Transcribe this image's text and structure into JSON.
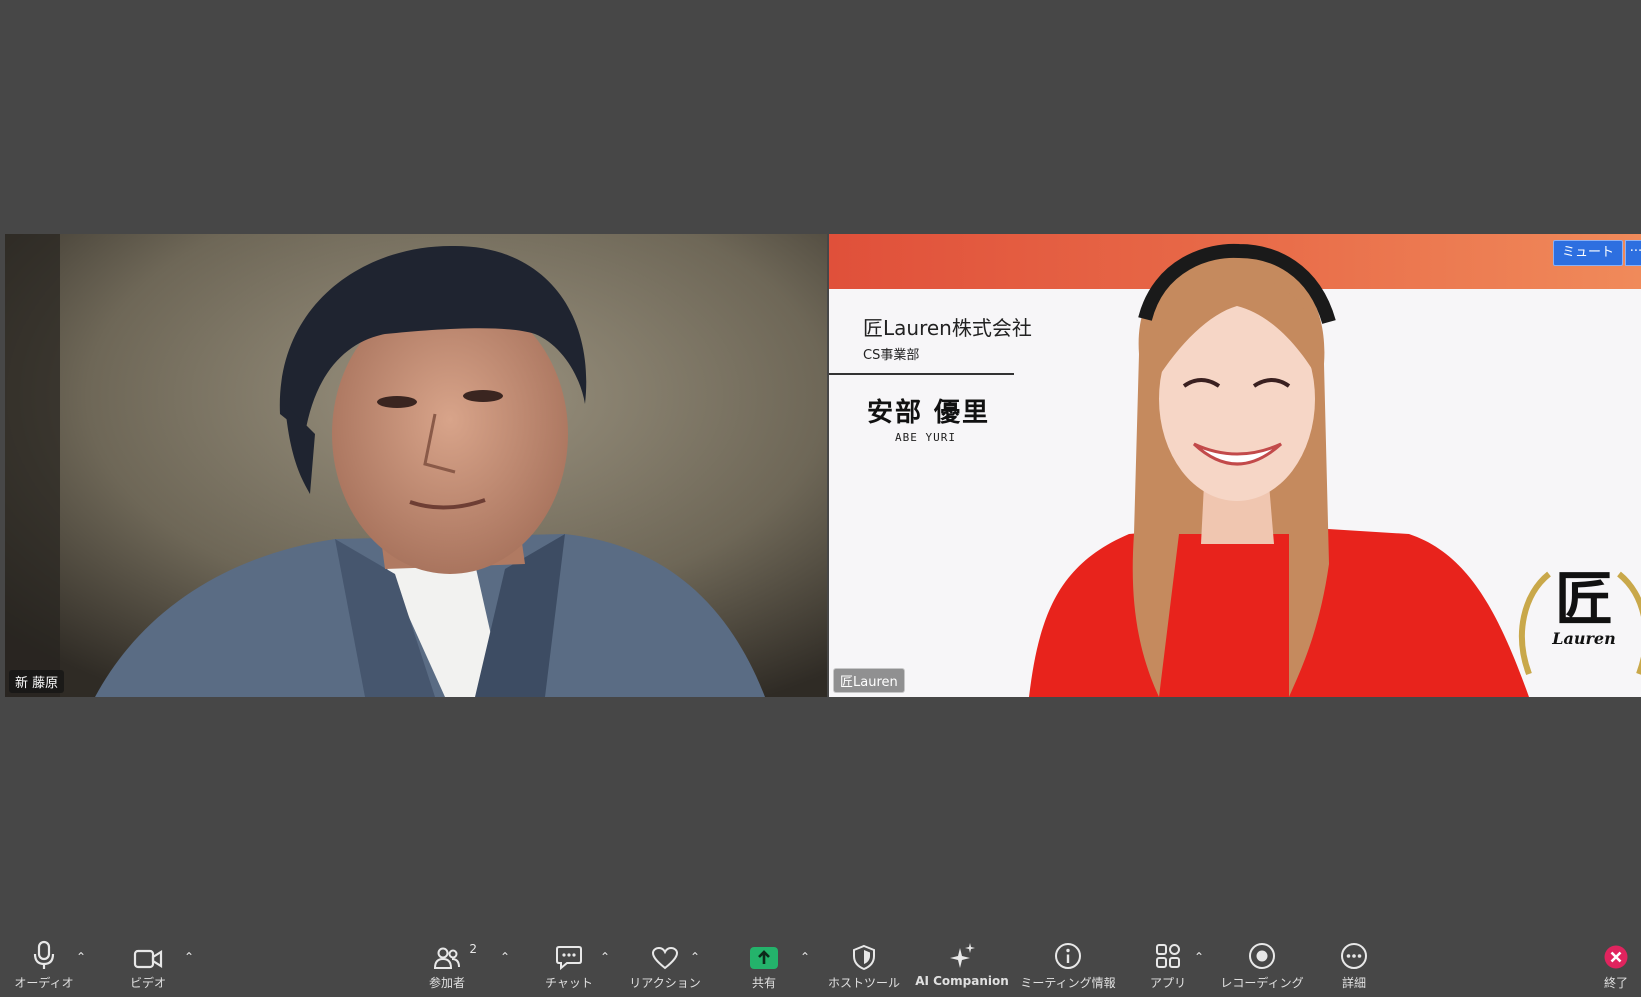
{
  "participants": {
    "left": {
      "name_tag": "新 藤原"
    },
    "right": {
      "name_tag": "匠Lauren",
      "mute_label": "ミュート",
      "more_label": "···",
      "background": {
        "company": "匠Lauren株式会社",
        "department": "CS事業部",
        "person_name": "安部 優里",
        "person_name_roman": "ABE YURI",
        "logo_text": "匠",
        "logo_subtext": "Lauren"
      }
    }
  },
  "toolbar": {
    "audio": {
      "label": "オーディオ",
      "icon": "microphone-icon"
    },
    "video": {
      "label": "ビデオ",
      "icon": "video-camera-icon"
    },
    "participants": {
      "label": "参加者",
      "count": "2",
      "icon": "people-icon"
    },
    "chat": {
      "label": "チャット",
      "icon": "chat-icon"
    },
    "reactions": {
      "label": "リアクション",
      "icon": "heart-icon"
    },
    "share": {
      "label": "共有",
      "icon": "share-arrow-icon",
      "color": "#24b36b"
    },
    "host_tools": {
      "label": "ホストツール",
      "icon": "shield-icon"
    },
    "ai_companion": {
      "label": "AI Companion",
      "icon": "sparkle-icon"
    },
    "meeting_info": {
      "label": "ミーティング情報",
      "icon": "info-icon"
    },
    "apps": {
      "label": "アプリ",
      "icon": "apps-icon"
    },
    "recording": {
      "label": "レコーディング",
      "icon": "record-icon"
    },
    "more": {
      "label": "詳細",
      "icon": "ellipsis-icon"
    },
    "end": {
      "label": "終了",
      "icon": "close-icon",
      "color": "#e0245e"
    }
  },
  "colors": {
    "background": "#474747",
    "accent_blue": "#2d6fe0",
    "banner_orange": "#e86a48",
    "shirt_red": "#e8231c"
  }
}
